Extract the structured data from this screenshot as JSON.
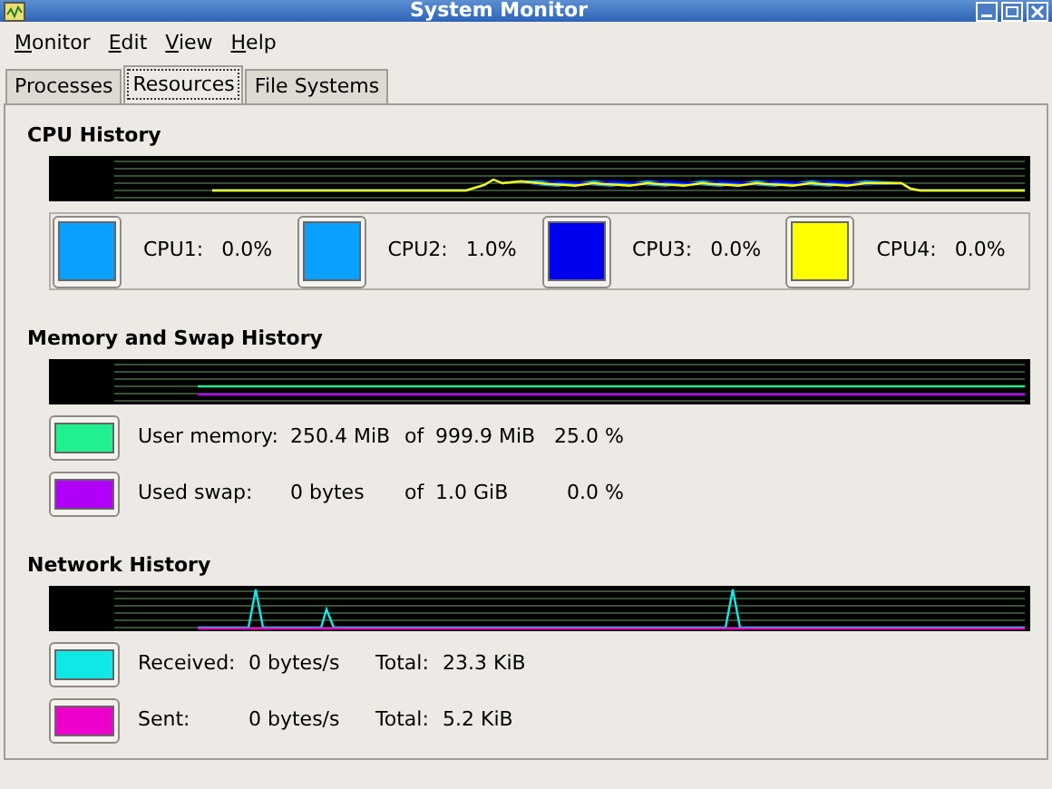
{
  "window": {
    "title": "System Monitor"
  },
  "menu": [
    {
      "label": "Monitor"
    },
    {
      "label": "Edit"
    },
    {
      "label": "View"
    },
    {
      "label": "Help"
    }
  ],
  "tabs": [
    {
      "label": "Processes",
      "selected": false
    },
    {
      "label": "Resources",
      "selected": true
    },
    {
      "label": "File Systems",
      "selected": false
    }
  ],
  "cpu": {
    "title": "CPU History",
    "cpus": [
      {
        "label": "CPU1:",
        "value": "0.0%",
        "color": "#0aa0ff"
      },
      {
        "label": "CPU2:",
        "value": "1.0%",
        "color": "#0aa0ff"
      },
      {
        "label": "CPU3:",
        "value": "0.0%",
        "color": "#0000f0"
      },
      {
        "label": "CPU4:",
        "value": "0.0%",
        "color": "#ffff00"
      }
    ]
  },
  "memory": {
    "title": "Memory and Swap History",
    "rows": [
      {
        "label": "User memory:",
        "used": "250.4 MiB",
        "of": "of",
        "total": "999.9 MiB",
        "percent": "25.0 %",
        "color": "#20f090"
      },
      {
        "label": "Used swap:",
        "used": "0 bytes",
        "of": "of",
        "total": "1.0 GiB",
        "percent": "0.0 %",
        "color": "#b000f8"
      }
    ]
  },
  "network": {
    "title": "Network History",
    "rows": [
      {
        "label": "Received:",
        "rate": "0 bytes/s",
        "total_label": "Total:",
        "total": "23.3 KiB",
        "color": "#10e8e8"
      },
      {
        "label": "Sent:",
        "rate": "0 bytes/s",
        "total_label": "Total:",
        "total": "5.2 KiB",
        "color": "#ee00cc"
      }
    ]
  }
}
